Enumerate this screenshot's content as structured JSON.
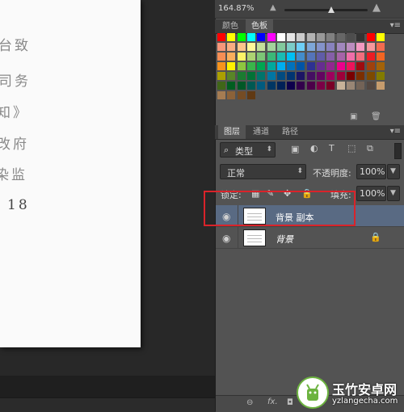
{
  "document": {
    "lines": [
      "台致",
      "司务",
      "知》",
      "改府",
      "染监"
    ],
    "page_number": "18"
  },
  "navigator": {
    "zoom": "164.87%"
  },
  "color_panel": {
    "tabs": [
      {
        "label": "颜色"
      },
      {
        "label": "色板"
      }
    ],
    "active_tab": "色板"
  },
  "swatches": [
    [
      "#ff0000",
      "#ffff00",
      "#00ff00",
      "#00ffff",
      "#0000ff",
      "#ff00ff",
      "#ffffff",
      "#e6e6e6",
      "#cccccc",
      "#b3b3b3",
      "#999999",
      "#808080",
      "#666666",
      "#4d4d4d",
      "#333333",
      "#ff0000",
      "#ffff00"
    ],
    [
      "#f7977a",
      "#f9ad81",
      "#fdc68a",
      "#fff79a",
      "#c4df9b",
      "#a3d39c",
      "#82ca9d",
      "#7bcdc8",
      "#6ecff6",
      "#7ea7d8",
      "#8493ca",
      "#8882be",
      "#a187be",
      "#bc8dbf",
      "#f49ac2",
      "#f6989d",
      "#f26c4f"
    ],
    [
      "#f68e55",
      "#fbaf5c",
      "#fff467",
      "#acd372",
      "#7cc576",
      "#3bb878",
      "#1abbb4",
      "#00bff3",
      "#438ccb",
      "#5574b9",
      "#605ca8",
      "#855fa8",
      "#a763a8",
      "#f06ea9",
      "#f26d7d",
      "#ed1c24",
      "#f26522"
    ],
    [
      "#f7941d",
      "#fff200",
      "#8dc73f",
      "#39b54a",
      "#00a651",
      "#00a99d",
      "#00aeef",
      "#0072bc",
      "#0054a6",
      "#2e3192",
      "#662d91",
      "#92278f",
      "#ec008c",
      "#ed145b",
      "#9e0b0f",
      "#a0410d",
      "#a36209"
    ],
    [
      "#aba000",
      "#598527",
      "#1a7b30",
      "#007236",
      "#00746b",
      "#0076a3",
      "#004b80",
      "#003471",
      "#1b1464",
      "#440e62",
      "#630460",
      "#9e005d",
      "#9e0039",
      "#790000",
      "#7b2e00",
      "#7d4900",
      "#827b00"
    ],
    [
      "#406618",
      "#005e20",
      "#005826",
      "#005952",
      "#005b7f",
      "#003663",
      "#002157",
      "#0d004c",
      "#32004b",
      "#4b0049",
      "#7b0046",
      "#7a0026",
      "#c7b299",
      "#998675",
      "#736357",
      "#534741",
      "#c69c6d"
    ],
    [
      "#a67c52",
      "#8c6239",
      "#754c24",
      "#603913"
    ]
  ],
  "layers_panel": {
    "tabs": [
      {
        "label": "图层"
      },
      {
        "label": "通道"
      },
      {
        "label": "路径"
      }
    ],
    "active_tab": "图层",
    "filter_kind": "类型",
    "blend_mode": "正常",
    "opacity_label": "不透明度:",
    "opacity_value": "100%",
    "lock_label": "锁定:",
    "fill_label": "填充:",
    "fill_value": "100%",
    "layers": [
      {
        "name": "背景 副本",
        "selected": true,
        "locked": false
      },
      {
        "name": "背景",
        "selected": false,
        "locked": true
      }
    ]
  },
  "watermark": {
    "title": "玉竹安卓网",
    "url": "yzlangecha.com"
  },
  "colors": {
    "selected_layer": "#596a83",
    "highlight_border": "#d9232a",
    "panel_bg": "#535353",
    "canvas_bg": "#282828"
  }
}
